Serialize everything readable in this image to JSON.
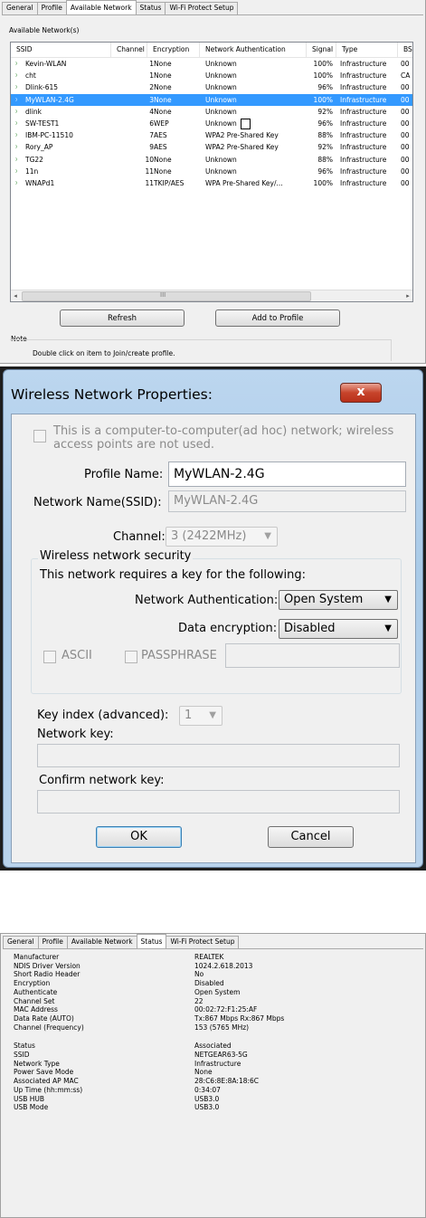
{
  "available_network": {
    "tabs": [
      "General",
      "Profile",
      "Available Network",
      "Status",
      "Wi-Fi Protect Setup"
    ],
    "list_title": "Available Network(s)",
    "columns": [
      "SSID",
      "Channel",
      "Encryption",
      "Network Authentication",
      "Signal",
      "Type",
      "BS"
    ],
    "networks": [
      {
        "ssid": "Kevin-WLAN",
        "channel": "1",
        "encryption": "None",
        "auth": "Unknown",
        "signal": "100%",
        "type": "Infrastructure",
        "bssid": "00"
      },
      {
        "ssid": "cht",
        "channel": "1",
        "encryption": "None",
        "auth": "Unknown",
        "signal": "100%",
        "type": "Infrastructure",
        "bssid": "CA"
      },
      {
        "ssid": "Dlink-615",
        "channel": "2",
        "encryption": "None",
        "auth": "Unknown",
        "signal": "96%",
        "type": "Infrastructure",
        "bssid": "00"
      },
      {
        "ssid": "MyWLAN-2.4G",
        "channel": "3",
        "encryption": "None",
        "auth": "Unknown",
        "signal": "100%",
        "type": "Infrastructure",
        "bssid": "00",
        "selected": true
      },
      {
        "ssid": "dlink",
        "channel": "4",
        "encryption": "None",
        "auth": "Unknown",
        "signal": "92%",
        "type": "Infrastructure",
        "bssid": "00"
      },
      {
        "ssid": "SW-TEST1",
        "channel": "6",
        "encryption": "WEP",
        "auth": "Unknown",
        "signal": "96%",
        "type": "Infrastructure",
        "bssid": "00"
      },
      {
        "ssid": "IBM-PC-11510",
        "channel": "7",
        "encryption": "AES",
        "auth": "WPA2 Pre-Shared Key",
        "signal": "88%",
        "type": "Infrastructure",
        "bssid": "00"
      },
      {
        "ssid": "Rory_AP",
        "channel": "9",
        "encryption": "AES",
        "auth": "WPA2 Pre-Shared Key",
        "signal": "92%",
        "type": "Infrastructure",
        "bssid": "00"
      },
      {
        "ssid": "TG22",
        "channel": "10",
        "encryption": "None",
        "auth": "Unknown",
        "signal": "88%",
        "type": "Infrastructure",
        "bssid": "00"
      },
      {
        "ssid": "11n",
        "channel": "11",
        "encryption": "None",
        "auth": "Unknown",
        "signal": "96%",
        "type": "Infrastructure",
        "bssid": "00"
      },
      {
        "ssid": "WNAPd1",
        "channel": "11",
        "encryption": "TKIP/AES",
        "auth": "WPA Pre-Shared Key/...",
        "signal": "100%",
        "type": "Infrastructure",
        "bssid": "00"
      }
    ],
    "signal_icon": "wifi-signal-icon",
    "scroll_left": "◂",
    "scroll_right": "▸",
    "scroll_grip": "III",
    "refresh_label": "Refresh",
    "add_label": "Add to Profile",
    "note_title": "Note",
    "note_text": "Double click on item to Join/create profile."
  },
  "dialog": {
    "title": "Wireless Network Properties:",
    "close_glyph": "x",
    "adhoc_text_1": "This is a computer-to-computer(ad hoc) network; wireless",
    "adhoc_text_2": "access points are not used.",
    "profile_name_label": "Profile Name:",
    "profile_name_value": "MyWLAN-2.4G",
    "ssid_label": "Network Name(SSID):",
    "ssid_value": "MyWLAN-2.4G",
    "channel_label": "Channel:",
    "channel_value": "3  (2422MHz)",
    "security_group": "Wireless network security",
    "requires_key_text": "This network requires a key for the following:",
    "auth_label": "Network Authentication:",
    "auth_value": "Open System",
    "encryption_label": "Data encryption:",
    "encryption_value": "Disabled",
    "ascii_label": "ASCII",
    "passphrase_label": "PASSPHRASE",
    "key_index_label": "Key index (advanced):",
    "key_index_value": "1",
    "network_key_label": "Network key:",
    "confirm_key_label": "Confirm network key:",
    "ok_label": "OK",
    "cancel_label": "Cancel",
    "title_color": "#aacbe8"
  },
  "status": {
    "tabs": [
      "General",
      "Profile",
      "Available Network",
      "Status",
      "Wi-Fi Protect Setup"
    ],
    "rows": [
      {
        "label": "Manufacturer",
        "value": "REALTEK"
      },
      {
        "label": "NDIS Driver Version",
        "value": "1024.2.618.2013"
      },
      {
        "label": "Short Radio Header",
        "value": "No"
      },
      {
        "label": "Encryption",
        "value": "Disabled"
      },
      {
        "label": "Authenticate",
        "value": "Open System"
      },
      {
        "label": "Channel Set",
        "value": "22"
      },
      {
        "label": "MAC Address",
        "value": "00:02:72:F1:25:AF"
      },
      {
        "label": "Data Rate (AUTO)",
        "value": "Tx:867 Mbps Rx:867 Mbps"
      },
      {
        "label": "Channel (Frequency)",
        "value": "153 (5765 MHz)"
      },
      {
        "label": "Status",
        "value": "Associated"
      },
      {
        "label": "SSID",
        "value": "NETGEAR63-5G"
      },
      {
        "label": "Network Type",
        "value": "Infrastructure"
      },
      {
        "label": "Power Save Mode",
        "value": "None"
      },
      {
        "label": "Associated AP MAC",
        "value": "28:C6:8E:8A:18:6C"
      },
      {
        "label": "Up Time (hh:mm:ss)",
        "value": "0:34:07"
      },
      {
        "label": "USB HUB",
        "value": "USB3.0"
      },
      {
        "label": "USB Mode",
        "value": "USB3.0"
      }
    ]
  }
}
